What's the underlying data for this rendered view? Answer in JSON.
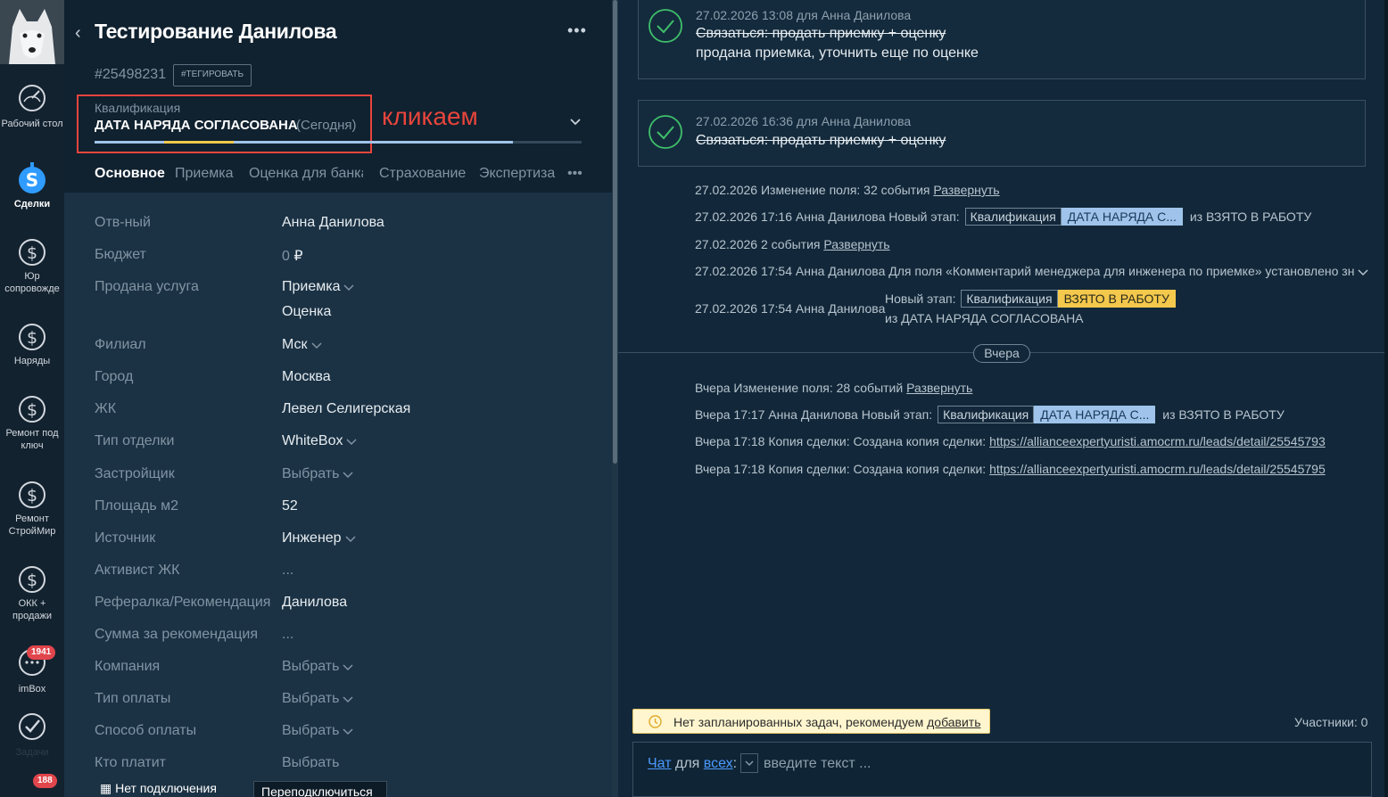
{
  "nav": {
    "items": [
      {
        "label": "Рабочий стол"
      },
      {
        "label": "Сделки"
      },
      {
        "label": "Юр сопровожде"
      },
      {
        "label": "Наряды"
      },
      {
        "label": "Ремонт под ключ"
      },
      {
        "label": "Ремонт СтройМир"
      },
      {
        "label": "ОКК + продажи"
      },
      {
        "label": "imBox",
        "badge": "1941"
      },
      {
        "label": "Задачи",
        "badge": "188"
      }
    ]
  },
  "card": {
    "title": "Тестирование Данилова",
    "id": "#25498231",
    "tag_button": "#ТЕГИРОВАТЬ",
    "pipeline_label": "Квалификация",
    "stage": "ДАТА НАРЯДА СОГЛАСОВАНА",
    "stage_date": "(Сегодня)",
    "annotation": "кликаем",
    "tabs": [
      "Основное",
      "Приемка",
      "Оценка для банка",
      "Страхование",
      "Экспертиза"
    ],
    "fields": [
      {
        "label": "Отв-ный",
        "value": "Анна Данилова"
      },
      {
        "label": "Бюджет",
        "value": "0",
        "suffix": "₽"
      },
      {
        "label": "Продана услуга",
        "value": "Приемка",
        "value2": "Оценка"
      },
      {
        "label": "Филиал",
        "value": "Мск"
      },
      {
        "label": "Город",
        "value": "Москва"
      },
      {
        "label": "ЖК",
        "value": "Левел Селигерская"
      },
      {
        "label": "Тип отделки",
        "value": "WhiteBox"
      },
      {
        "label": "Застройщик",
        "value": "Выбрать"
      },
      {
        "label": "Площадь м2",
        "value": "52"
      },
      {
        "label": "Источник",
        "value": "Инженер"
      },
      {
        "label": "Активист ЖК",
        "value": "..."
      },
      {
        "label": "Рефералка/Рекомендация",
        "value": "Данилова"
      },
      {
        "label": "Сумма за рекомендация",
        "value": "..."
      },
      {
        "label": "Компания",
        "value": "Выбрать"
      },
      {
        "label": "Тип оплаты",
        "value": "Выбрать"
      },
      {
        "label": "Способ оплаты",
        "value": "Выбрать"
      },
      {
        "label": "Кто платит",
        "value": "Выбрать"
      }
    ],
    "bottom_status": "Нет подключения",
    "reconnect_button": "Переподключиться"
  },
  "feed": {
    "tasks": [
      {
        "meta": "27.02.2026 13:08  для Анна Данилова",
        "struck": "Связаться: продать приемку + оценку",
        "result": "продана приемка, уточнить еще по оценке"
      },
      {
        "meta": "27.02.2026 16:36  для Анна Данилова",
        "struck": "Связаться: продать приемку + оценку"
      }
    ],
    "ev1": {
      "text": "27.02.2026 Изменение поля: 32 события",
      "link": "Развернуть"
    },
    "ev2": {
      "text": "27.02.2026 17:16 Анна Данилова Новый этап:",
      "pipe": "Квалификация",
      "stage": "ДАТА НАРЯДА С...",
      "tail": "из ВЗЯТО В РАБОТУ"
    },
    "ev3": {
      "text": "27.02.2026 2 события",
      "link": "Развернуть"
    },
    "ev4": {
      "text": "27.02.2026 17:54 Анна Данилова Для поля «Комментарий менеджера для инженера по приемке» установлено зн"
    },
    "ev5": {
      "who": "27.02.2026 17:54 Анна Данилова",
      "label": "Новый этап:",
      "pipe": "Квалификация",
      "stage": "ВЗЯТО В РАБОТУ",
      "tail": "из ДАТА НАРЯДА СОГЛАСОВАНА"
    },
    "divider": "Вчера",
    "ev6": {
      "text": "Вчера Изменение поля: 28 событий",
      "link": "Развернуть"
    },
    "ev7": {
      "text": "Вчера 17:17 Анна Данилова Новый этап:",
      "pipe": "Квалификация",
      "stage": "ДАТА НАРЯДА С...",
      "tail": "из ВЗЯТО В РАБОТУ"
    },
    "ev8": {
      "text": "Вчера 17:18 Копия сделки: Создана копия сделки:",
      "link": "https://allianceexpertyuristi.amocrm.ru/leads/detail/25545793"
    },
    "ev9": {
      "text": "Вчера 17:18 Копия сделки: Создана копия сделки:",
      "link": "https://allianceexpertyuristi.amocrm.ru/leads/detail/25545795"
    },
    "notask_text": "Нет запланированных задач, рекомендуем",
    "notask_link": "добавить",
    "participants": "Участники: 0",
    "chat_mode": "Чат",
    "chat_for": "для",
    "chat_target": "всех",
    "chat_placeholder": "введите текст ..."
  },
  "colors": {
    "accent_red": "#e8453c",
    "stage_blue": "#9fc3ea",
    "stage_yellow": "#f3c84c",
    "link_blue": "#4b9bff"
  }
}
